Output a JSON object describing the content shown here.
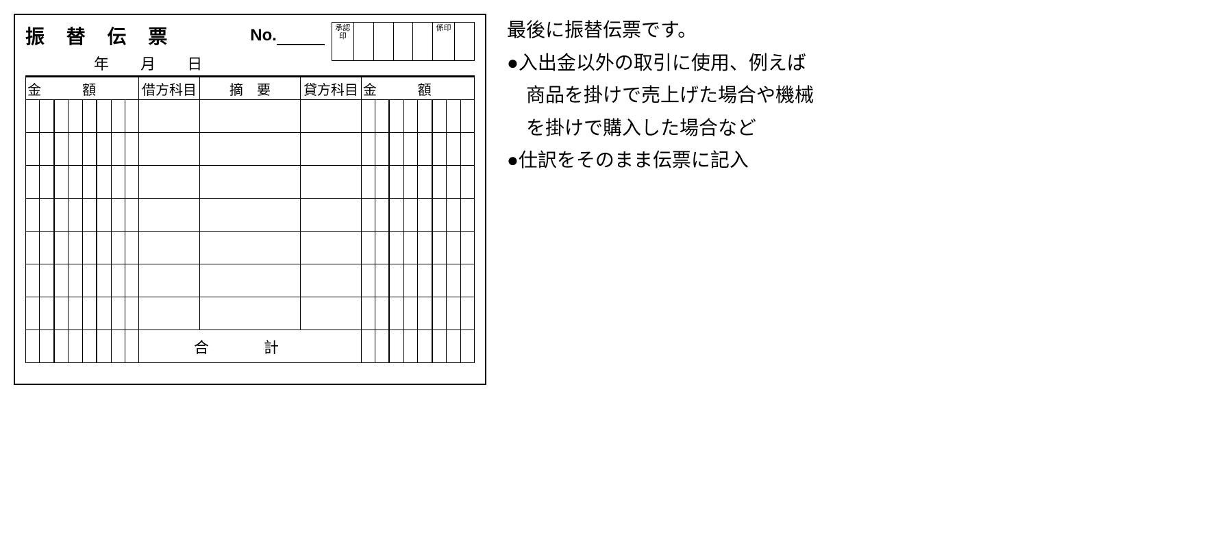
{
  "slip": {
    "title": "振 替 伝 票",
    "no_label": "No.",
    "date": {
      "year": "年",
      "month": "月",
      "day": "日"
    },
    "stamps": {
      "approve": "承認印",
      "clerk": "係印"
    },
    "headers": {
      "amount_left": "金額",
      "debit": "借方科目",
      "summary": "摘　要",
      "credit": "貸方科目",
      "amount_right": "金額"
    },
    "total_label": "合計",
    "row_count": 7
  },
  "explain": {
    "intro": "最後に振替伝票です。",
    "b1_l1": "入出金以外の取引に使用、例えば",
    "b1_l2": "商品を掛けで売上げた場合や機械",
    "b1_l3": "を掛けで購入した場合など",
    "b2": "仕訳をそのまま伝票に記入"
  }
}
